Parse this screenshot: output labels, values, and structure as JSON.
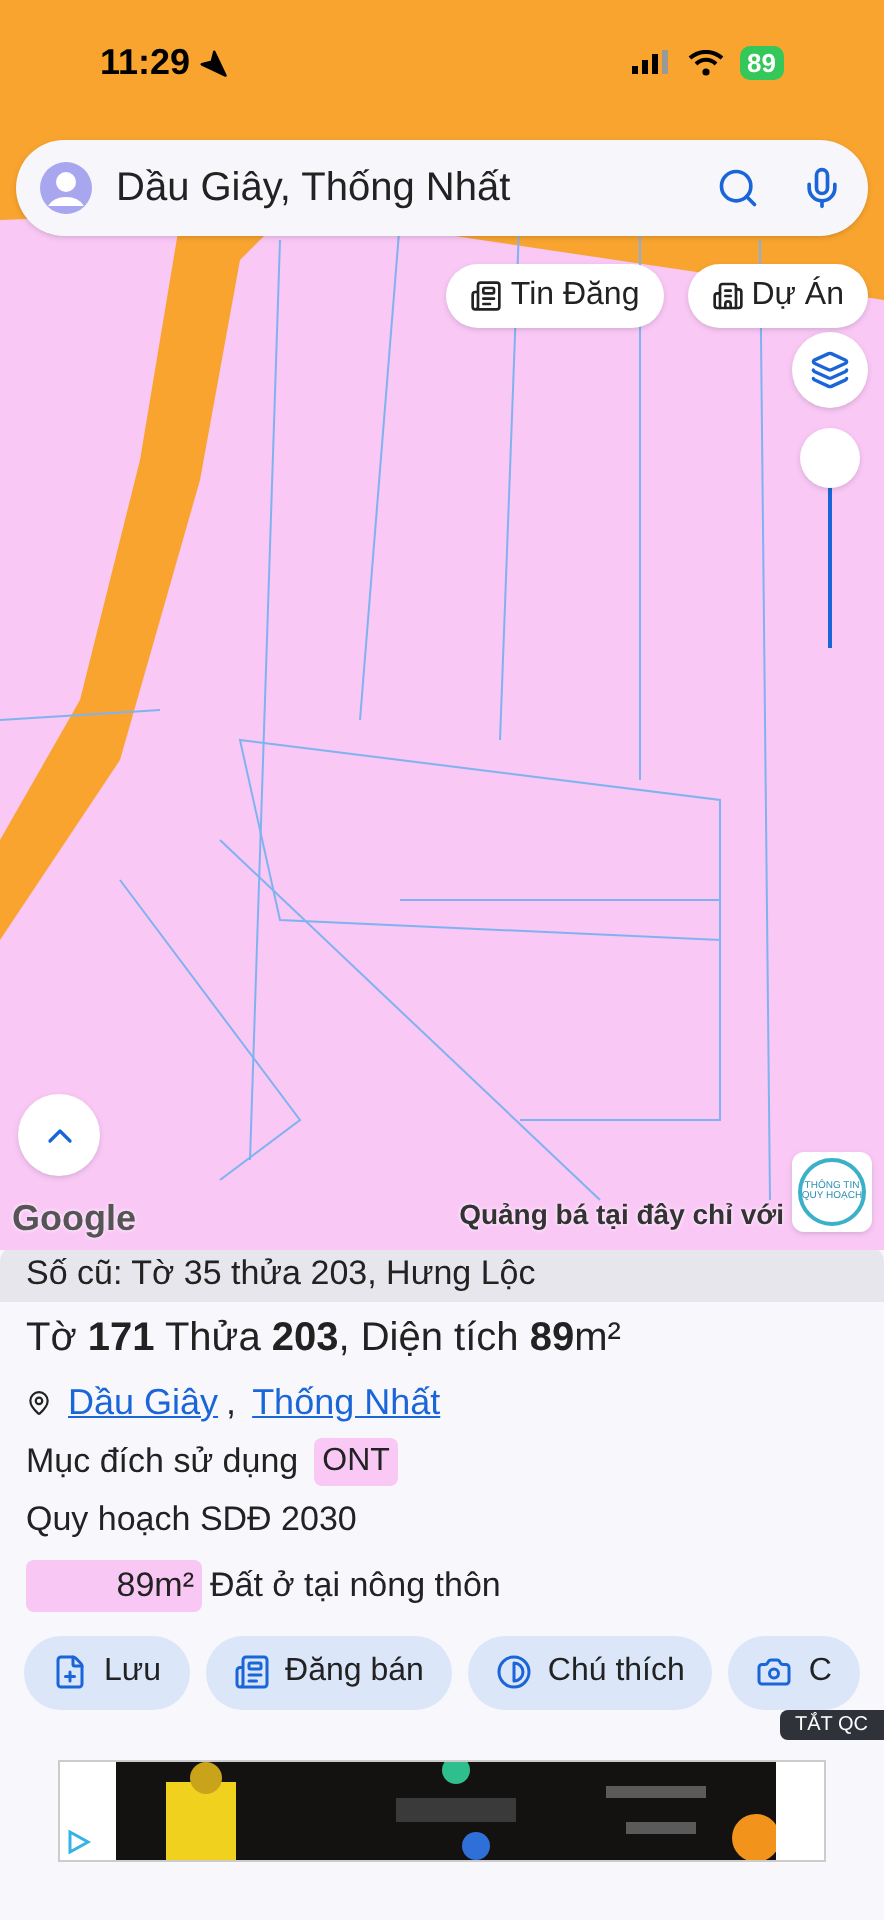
{
  "status_bar": {
    "time": "11:29",
    "battery": "89"
  },
  "search": {
    "value": "Dầu Giây, Thống Nhất"
  },
  "map_chips": [
    {
      "label": "Tin Đăng",
      "kind": "listing"
    },
    {
      "label": "Dự Án",
      "kind": "project"
    }
  ],
  "zoom_slider": {
    "level": 1
  },
  "map_overlay": {
    "attribution": "Google",
    "promo": "Quảng bá tại đây chỉ với",
    "badge_line_1": "THÔNG TIN",
    "badge_line_2": "QUY HOẠCH"
  },
  "parcel": {
    "old_number": "Số cũ: Tờ 35 thửa 203, Hưng Lộc",
    "title": "Tờ **171** Thửa **203**, Diện tích **89**m²",
    "locations": [
      "Dầu Giây",
      "Thống Nhất"
    ],
    "location_separator": ",",
    "purpose_label": "Mục đích sử dụng",
    "purpose_code": "ONT",
    "plan": "Quy hoạch SDĐ 2030",
    "zones": [
      {
        "area": "89m²",
        "name": "Đất ở tại nông thôn",
        "color": "#f9c7f3"
      }
    ]
  },
  "actions": [
    {
      "label": "Lưu",
      "kind": "save"
    },
    {
      "label": "Đăng bán",
      "kind": "post"
    },
    {
      "label": "Chú thích",
      "kind": "legend"
    },
    {
      "label": "C",
      "kind": "camera"
    }
  ],
  "ad": {
    "close_label": "TẮT QC"
  }
}
